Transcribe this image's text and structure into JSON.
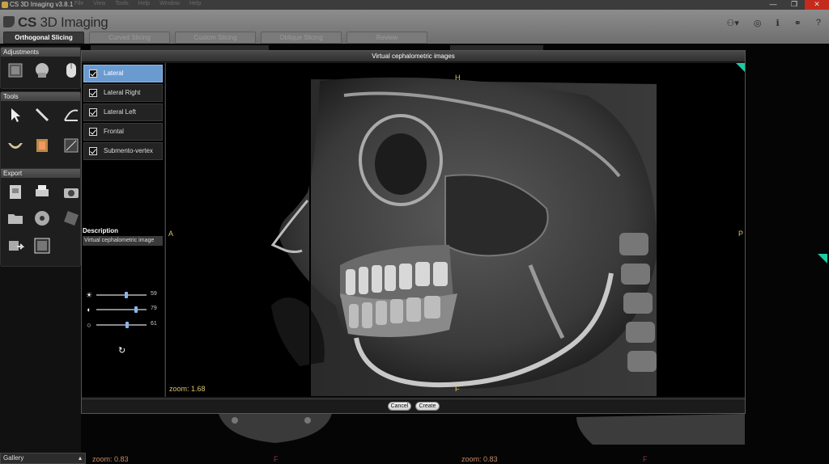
{
  "window": {
    "title": "CS 3D Imaging v3.8.1",
    "menu": [
      "File",
      "View",
      "Tools",
      "Help",
      "Window",
      "Help"
    ],
    "controls": {
      "minimize": "—",
      "maximize": "❐",
      "close": "✕"
    }
  },
  "header": {
    "logo_prefix": "CS",
    "logo_text": "3D Imaging",
    "icons": [
      "user-icon",
      "settings-icon",
      "info-icon",
      "network-icon",
      "help-icon"
    ],
    "icon_glyphs": {
      "user": "⚇▾",
      "settings": "◎",
      "info": "ℹ",
      "network": "⚭",
      "help": "?"
    }
  },
  "tabs": [
    {
      "label": "Orthogonal Slicing",
      "active": true
    },
    {
      "label": "Curved Slicing",
      "active": false
    },
    {
      "label": "Custom Slicing",
      "active": false
    },
    {
      "label": "Oblique Slicing",
      "active": false
    },
    {
      "label": "Review",
      "active": false
    }
  ],
  "left_panel": {
    "adjustments_title": "Adjustments",
    "tools_title": "Tools",
    "export_title": "Export",
    "gallery_label": "Gallery"
  },
  "background": {
    "zoom_left": "zoom: 0.83",
    "zoom_right": "zoom: 0.83",
    "f_marker": "F"
  },
  "dialog": {
    "title": "Virtual cephalometric images",
    "views": [
      {
        "label": "Lateral",
        "checked": true,
        "selected": true
      },
      {
        "label": "Lateral Right",
        "checked": true,
        "selected": false
      },
      {
        "label": "Lateral Left",
        "checked": true,
        "selected": false
      },
      {
        "label": "Frontal",
        "checked": true,
        "selected": false
      },
      {
        "label": "Submento-vertex",
        "checked": true,
        "selected": false
      }
    ],
    "description_label": "Description",
    "description_value": "Virtual cephalometric image",
    "sliders": [
      {
        "name": "brightness",
        "icon": "☀",
        "value": 59,
        "fraction": 0.59
      },
      {
        "name": "contrast",
        "icon": "◐",
        "value": 79,
        "fraction": 0.79
      },
      {
        "name": "gamma",
        "icon": "○",
        "value": 61,
        "fraction": 0.61
      }
    ],
    "reset_icon": "↻",
    "orientation": {
      "top": "H",
      "bottom": "F",
      "left": "A",
      "right": "P"
    },
    "zoom": "zoom: 1.68",
    "buttons": {
      "cancel": "Cancel",
      "create": "Create"
    }
  },
  "colors": {
    "selection": "#6a9bd0",
    "orientation_text": "#d8c46a",
    "corner_marker": "#1ec9a3",
    "close_button": "#c42b1c"
  }
}
